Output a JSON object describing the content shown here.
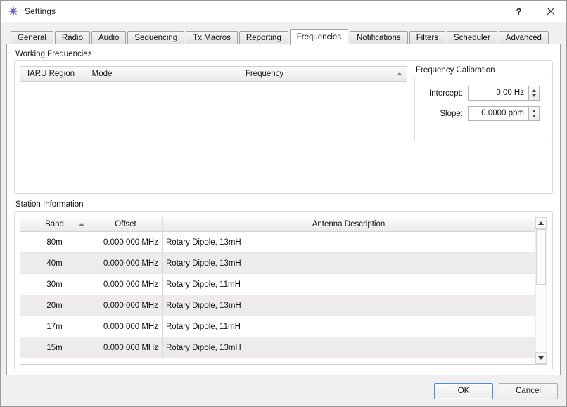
{
  "window": {
    "title": "Settings",
    "icon": "app-star-icon",
    "help_label": "?",
    "close_label": "×"
  },
  "tabs": [
    {
      "label": "General",
      "accel": "l",
      "selected": false
    },
    {
      "label": "Radio",
      "accel": "R",
      "selected": false
    },
    {
      "label": "Audio",
      "accel": "u",
      "selected": false
    },
    {
      "label": "Sequencing",
      "accel": "",
      "selected": false
    },
    {
      "label": "Tx Macros",
      "accel": "M",
      "selected": false
    },
    {
      "label": "Reporting",
      "accel": "g",
      "selected": false
    },
    {
      "label": "Frequencies",
      "accel": "",
      "selected": true
    },
    {
      "label": "Notifications",
      "accel": "",
      "selected": false
    },
    {
      "label": "Filters",
      "accel": "",
      "selected": false
    },
    {
      "label": "Scheduler",
      "accel": "",
      "selected": false
    },
    {
      "label": "Advanced",
      "accel": "",
      "selected": false
    }
  ],
  "working_frequencies": {
    "group_title": "Working Frequencies",
    "columns": [
      "IARU Region",
      "Mode",
      "Frequency"
    ],
    "sorted_column": "Frequency",
    "sort_direction": "ascending",
    "rows": []
  },
  "frequency_calibration": {
    "group_title": "Frequency Calibration",
    "fields": [
      {
        "label": "Intercept:",
        "value": "0.00 Hz"
      },
      {
        "label": "Slope:",
        "value": "0.0000 ppm"
      }
    ]
  },
  "station_information": {
    "group_title": "Station Information",
    "columns": [
      "Band",
      "Offset",
      "Antenna Description"
    ],
    "sorted_column": "Band",
    "sort_direction": "ascending",
    "rows": [
      {
        "band": "80m",
        "offset": "0.000 000 MHz",
        "antenna": "Rotary Dipole, 13mH"
      },
      {
        "band": "40m",
        "offset": "0.000 000 MHz",
        "antenna": "Rotary Dipole, 13mH"
      },
      {
        "band": "30m",
        "offset": "0.000 000 MHz",
        "antenna": "Rotary Dipole, 11mH"
      },
      {
        "band": "20m",
        "offset": "0.000 000 MHz",
        "antenna": "Rotary Dipole, 13mH"
      },
      {
        "band": "17m",
        "offset": "0.000 000 MHz",
        "antenna": "Rotary Dipole, 11mH"
      },
      {
        "band": "15m",
        "offset": "0.000 000 MHz",
        "antenna": "Rotary Dipole, 13mH"
      }
    ]
  },
  "footer": {
    "ok_label": "OK",
    "ok_accel": "O",
    "cancel_label": "Cancel",
    "cancel_accel": "C"
  },
  "colors": {
    "accent": "#4a90d9",
    "window_bg": "#f0f0f0",
    "panel_bg": "#ffffff",
    "row_alt": "#eeecea",
    "icon": "#5b5bd6"
  }
}
